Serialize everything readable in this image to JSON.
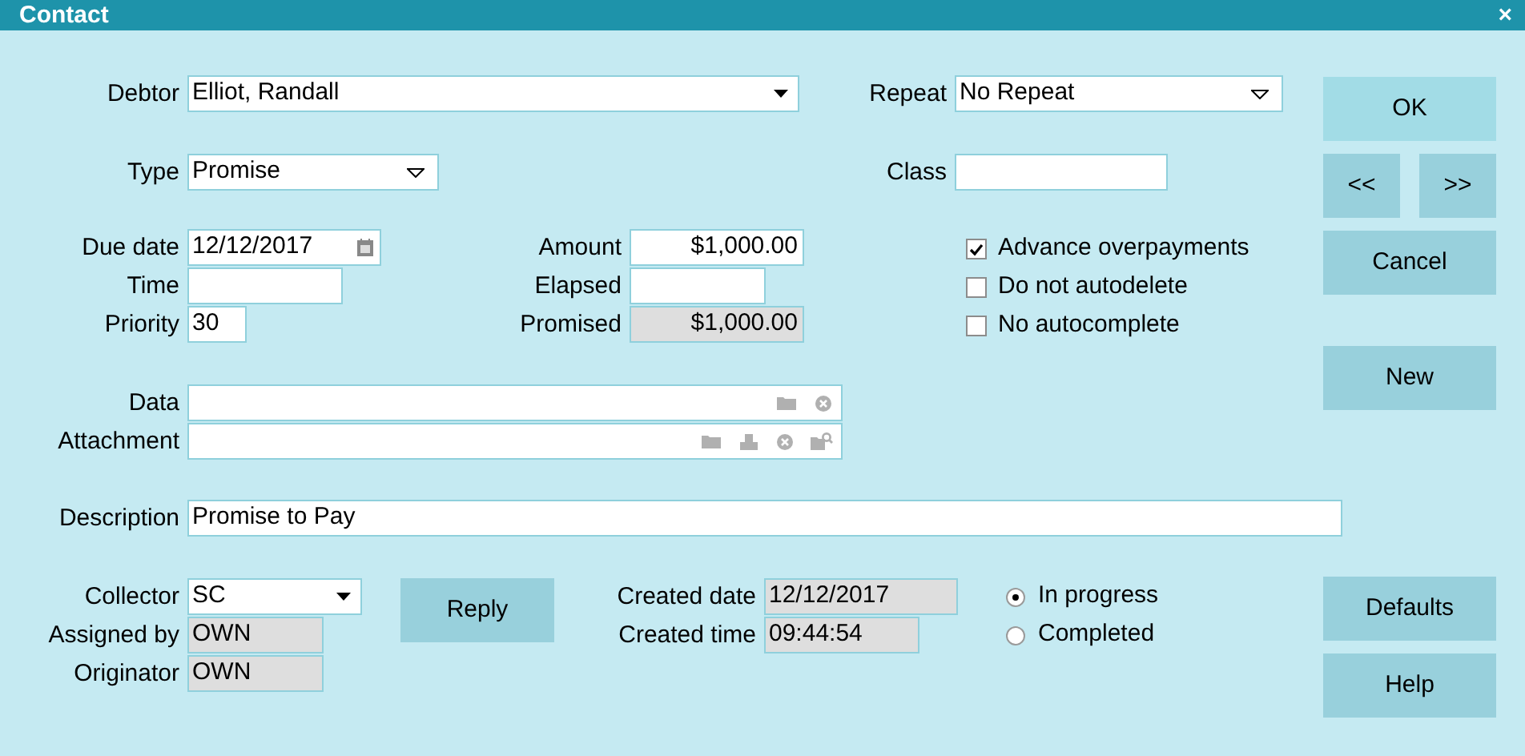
{
  "window": {
    "title": "Contact",
    "close": "×"
  },
  "debtor": {
    "label": "Debtor",
    "value": "Elliot, Randall"
  },
  "repeat": {
    "label": "Repeat",
    "value": "No Repeat"
  },
  "type": {
    "label": "Type",
    "value": "Promise"
  },
  "class": {
    "label": "Class"
  },
  "schedule": [
    {
      "label": "Due date",
      "value": "12/12/2017"
    },
    {
      "label": "Time"
    },
    {
      "label": "Priority",
      "value": "30"
    }
  ],
  "amounts": [
    {
      "label": "Amount",
      "value": "$1,000.00",
      "disabled": false
    },
    {
      "label": "Elapsed",
      "disabled": false
    },
    {
      "label": "Promised",
      "value": "$1,000.00",
      "disabled": true
    }
  ],
  "options": [
    {
      "label": "Advance overpayments",
      "checked": true
    },
    {
      "label": "Do not autodelete",
      "checked": false
    },
    {
      "label": "No autocomplete",
      "checked": false
    }
  ],
  "data": {
    "label": "Data"
  },
  "attachment": {
    "label": "Attachment"
  },
  "description": {
    "label": "Description",
    "value": "Promise to Pay"
  },
  "people": [
    {
      "label": "Collector",
      "value": "SC",
      "disabled": false
    },
    {
      "label": "Assigned by",
      "value": "OWN",
      "disabled": true
    },
    {
      "label": "Originator",
      "value": "OWN",
      "disabled": true
    }
  ],
  "created": [
    {
      "label": "Created date",
      "value": "12/12/2017",
      "disabled": true
    },
    {
      "label": "Created time",
      "value": "09:44:54",
      "disabled": true
    }
  ],
  "status": [
    {
      "label": "In progress",
      "selected": true
    },
    {
      "label": "Completed",
      "selected": false
    }
  ],
  "reply": "Reply",
  "buttons": {
    "ok": "OK",
    "prev": "<<",
    "next": ">>",
    "cancel": "Cancel",
    "new": "New",
    "defaults": "Defaults",
    "help": "Help"
  }
}
